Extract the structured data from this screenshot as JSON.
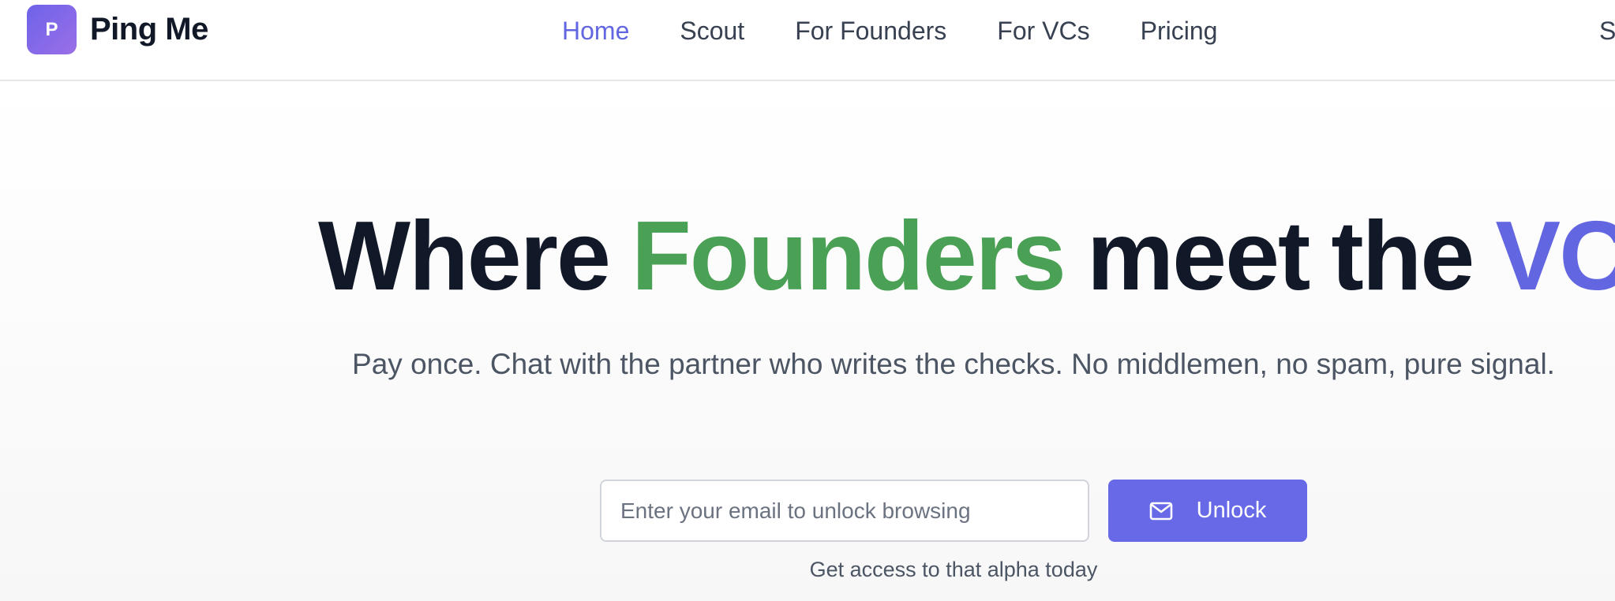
{
  "brand": {
    "logo_letter": "P",
    "name": "Ping Me",
    "accent": "#6366e1",
    "green": "#4aa054"
  },
  "nav": {
    "items": [
      {
        "label": "Home",
        "active": true
      },
      {
        "label": "Scout",
        "active": false
      },
      {
        "label": "For Founders",
        "active": false
      },
      {
        "label": "For VCs",
        "active": false
      },
      {
        "label": "Pricing",
        "active": false
      }
    ],
    "cut_off_item": "S"
  },
  "hero": {
    "title_parts": [
      "Where",
      "Founders",
      "meet",
      "the",
      "VC"
    ],
    "subtitle": "Pay once. Chat with the partner who writes the checks. No middlemen, no spam, pure signal."
  },
  "form": {
    "email_placeholder": "Enter your email to unlock browsing",
    "email_value": "",
    "button_icon": "mail-icon",
    "button_label": "Unlock",
    "helper_text": "Get access to that alpha today"
  }
}
